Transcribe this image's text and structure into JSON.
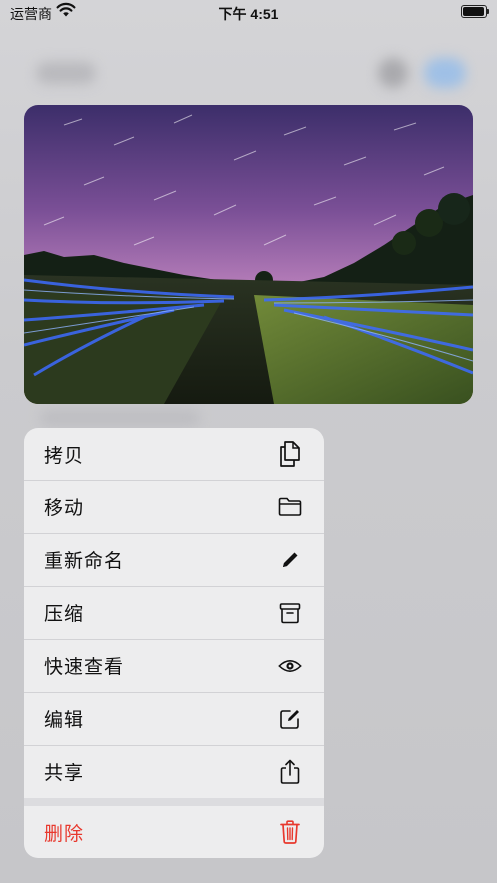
{
  "status_bar": {
    "carrier": "运营商",
    "time": "下午 4:51"
  },
  "preview": {
    "description_icon": "photo-thumbnail"
  },
  "menu": {
    "items": [
      {
        "label": "拷贝",
        "icon": "copy-icon"
      },
      {
        "label": "移动",
        "icon": "folder-icon"
      },
      {
        "label": "重新命名",
        "icon": "pencil-icon"
      },
      {
        "label": "压缩",
        "icon": "archive-icon"
      },
      {
        "label": "快速查看",
        "icon": "eye-icon"
      },
      {
        "label": "编辑",
        "icon": "edit-icon"
      },
      {
        "label": "共享",
        "icon": "share-icon"
      }
    ],
    "delete": {
      "label": "删除",
      "icon": "trash-icon"
    }
  },
  "colors": {
    "destructive": "#e8382d",
    "menu_bg": "#ededee"
  }
}
